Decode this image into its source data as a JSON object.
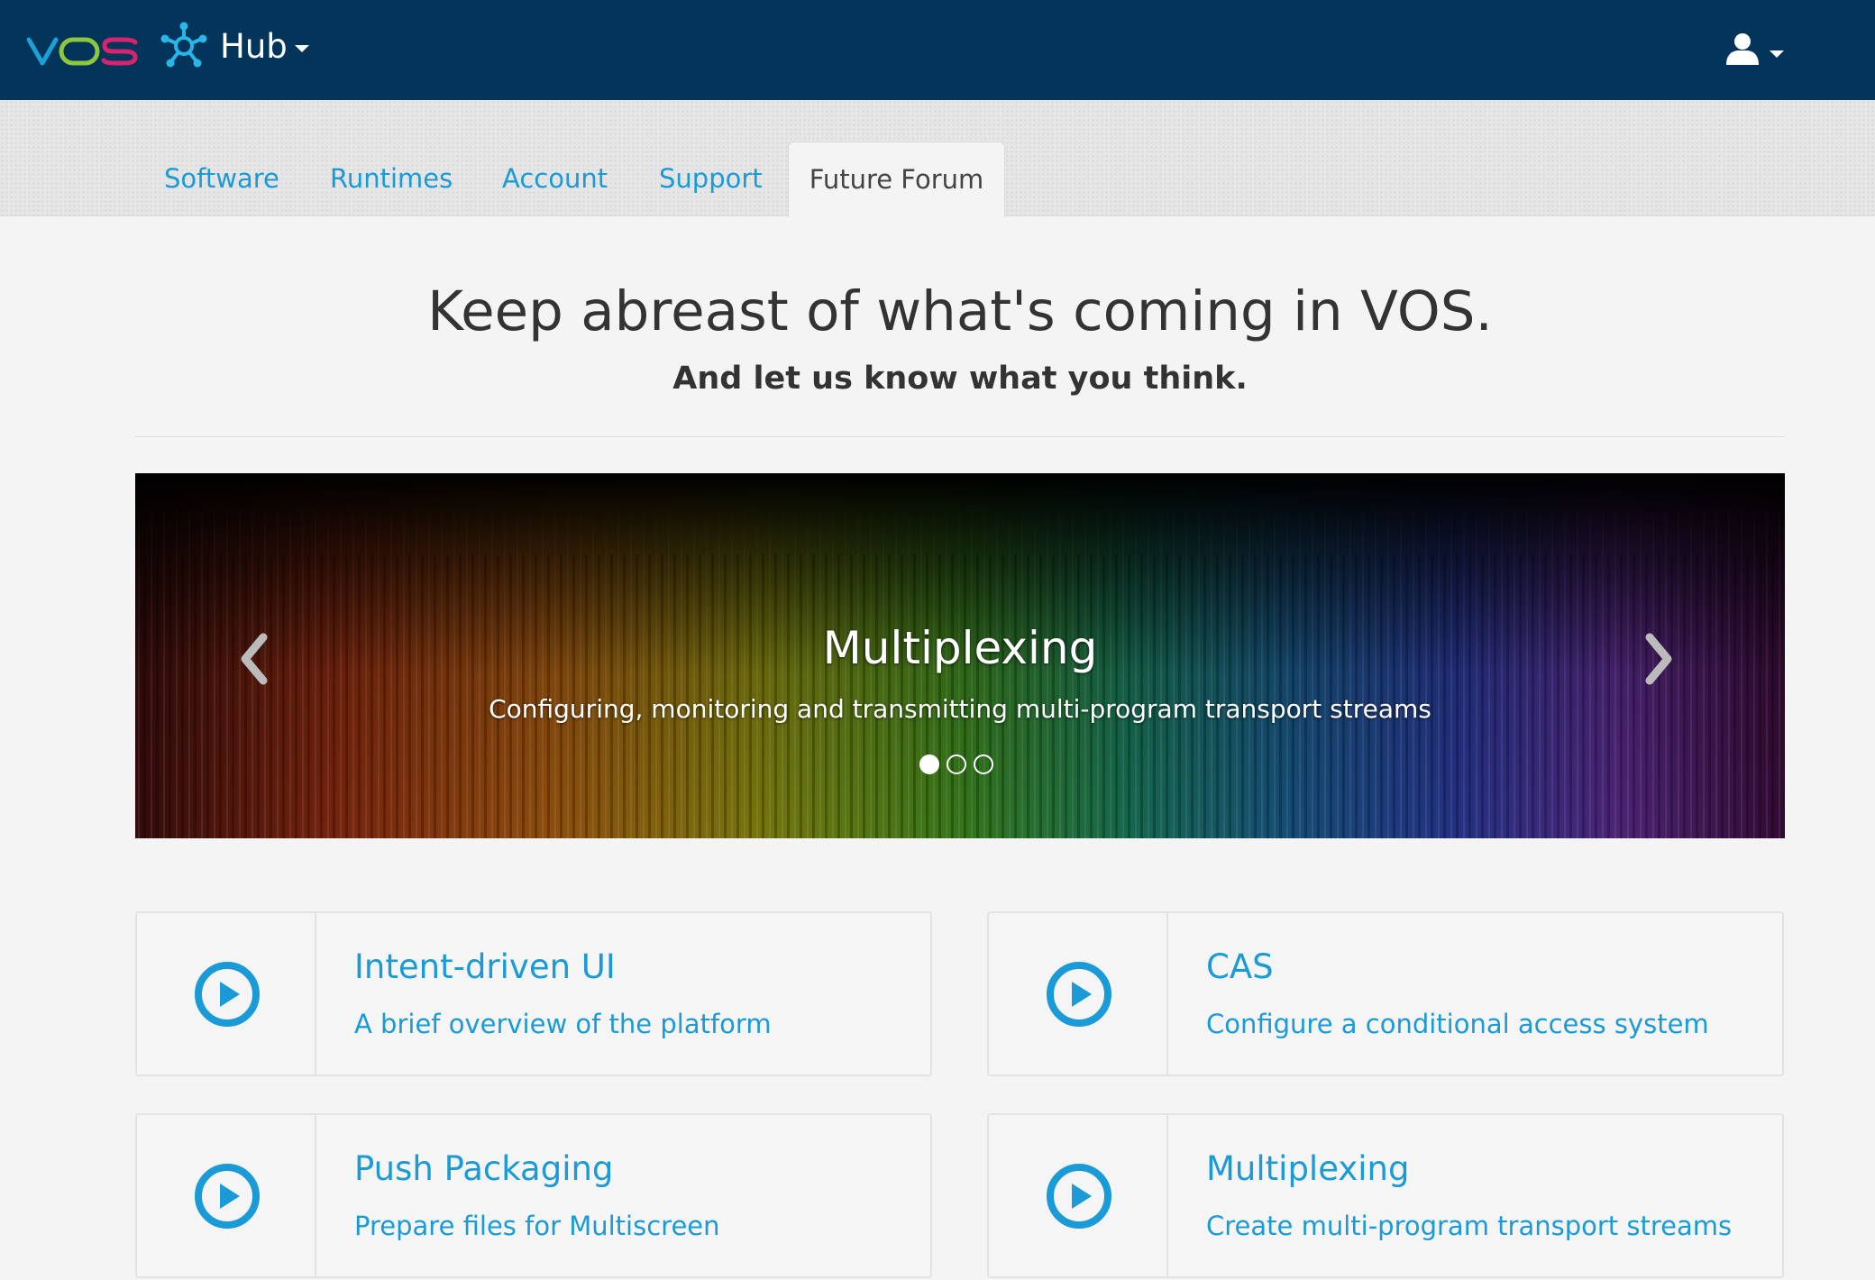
{
  "header": {
    "brand": "VOS",
    "app_name": "Hub",
    "icons": {
      "hub": "hub-network-icon",
      "user": "user-icon"
    },
    "colors": {
      "bar": "#03345a",
      "brand_v": "#1aa1d6",
      "brand_o": "#8dc63f",
      "brand_s": "#d6246e"
    }
  },
  "tabs": [
    {
      "label": "Software"
    },
    {
      "label": "Runtimes"
    },
    {
      "label": "Account"
    },
    {
      "label": "Support"
    },
    {
      "label": "Future Forum",
      "active": true
    }
  ],
  "hero": {
    "title": "Keep abreast of what's coming in VOS.",
    "subtitle": "And let us know what you think."
  },
  "carousel": {
    "title": "Multiplexing",
    "caption": "Configuring, monitoring and transmitting multi-program transport streams",
    "slide_count": 3,
    "active_index": 0
  },
  "cards": [
    {
      "title": "Intent-driven UI",
      "description": "A brief overview of the platform",
      "icon": "play-circle-icon"
    },
    {
      "title": "CAS",
      "description": "Configure a conditional access system",
      "icon": "play-circle-icon"
    },
    {
      "title": "Push Packaging",
      "description": "Prepare files for Multiscreen",
      "icon": "play-circle-icon"
    },
    {
      "title": "Multiplexing",
      "description": "Create multi-program transport streams",
      "icon": "play-circle-icon"
    }
  ],
  "accent_color": "#1a9ad6"
}
